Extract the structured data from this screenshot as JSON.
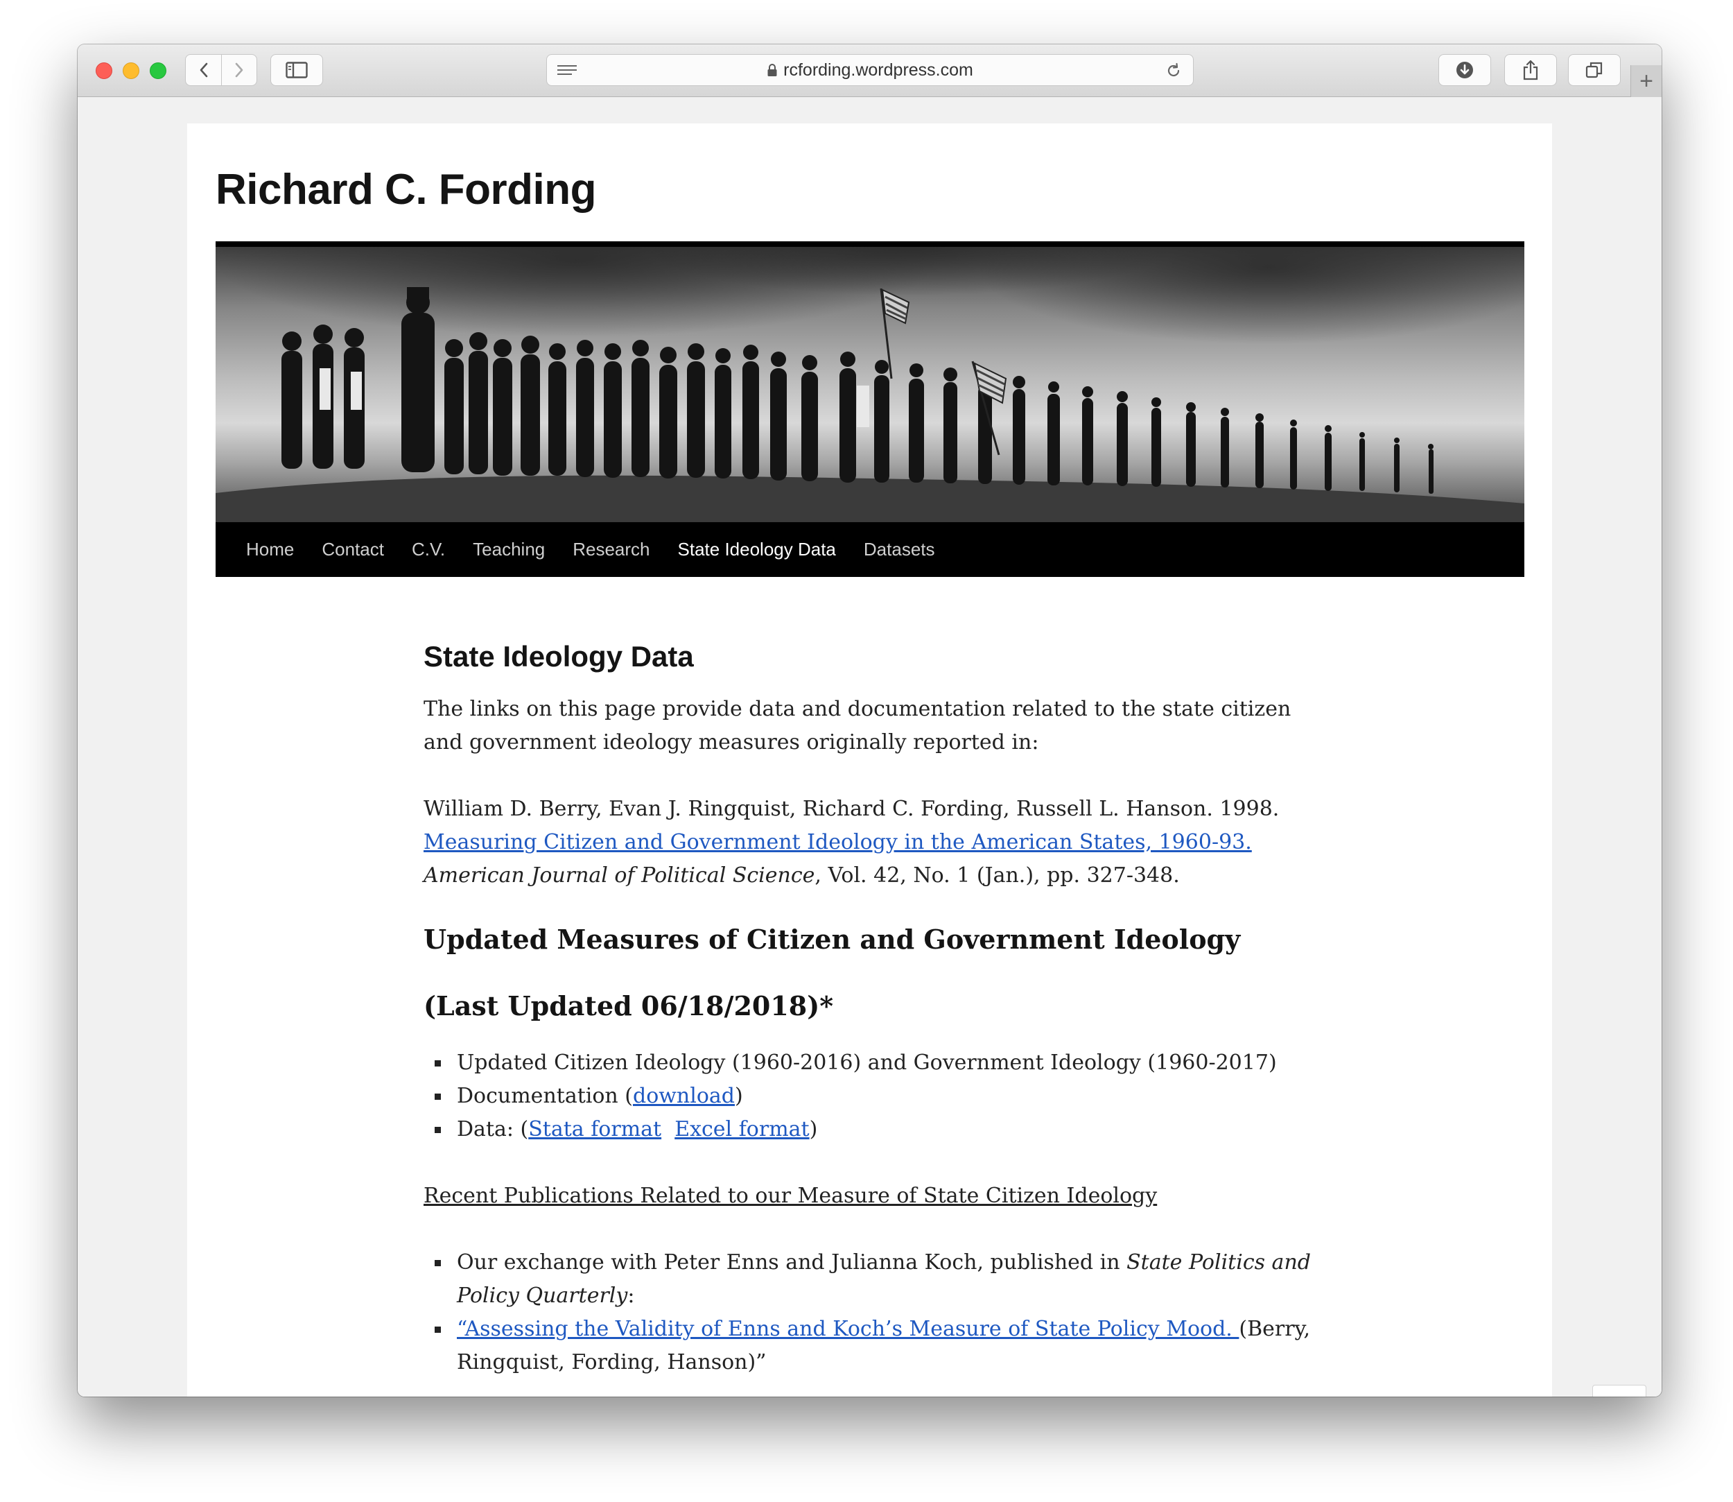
{
  "browser": {
    "url": "rcfording.wordpress.com"
  },
  "site": {
    "title": "Richard C. Fording"
  },
  "nav": {
    "items": [
      "Home",
      "Contact",
      "C.V.",
      "Teaching",
      "Research",
      "State Ideology Data",
      "Datasets"
    ],
    "current": "State Ideology Data"
  },
  "content": {
    "page_title": "State Ideology Data",
    "intro": " The links on this page provide data and documentation related to the state citizen and government ideology measures originally reported in:",
    "citation": {
      "authors": "William D. Berry, Evan J. Ringquist, Richard C. Fording, Russell L. Hanson. 1998.",
      "title_link": "Measuring Citizen and Government Ideology in the American States, 1960-93.",
      "journal": "American Journal of Political Science",
      "details": ", Vol. 42, No. 1 (Jan.), pp. 327-348."
    },
    "updated_heading_1": "Updated Measures of Citizen and Government Ideology",
    "updated_heading_2": "(Last Updated 06/18/2018)*",
    "list_1": {
      "item_1": "Updated Citizen Ideology (1960-2016) and Government Ideology (1960-2017)",
      "item_2_prefix": "Documentation (",
      "item_2_link": "download",
      "item_2_suffix": ")",
      "item_3_prefix": "Data: (",
      "item_3_link_1": "Stata format",
      "item_3_link_2": "Excel format",
      "item_3_suffix": ")"
    },
    "recent_heading": "Recent Publications Related to our Measure of State Citizen Ideology",
    "list_2": {
      "item_1_prefix": "Our exchange with Peter Enns and Julianna Koch, published in ",
      "item_1_journal": "State Politics and Policy Quarterly",
      "item_1_suffix": ":",
      "item_2_link": "“Assessing the Validity of Enns and Koch’s Measure of State Policy Mood. ",
      "item_2_suffix": "(Berry, Ringquist, Fording, Hanson)”"
    }
  },
  "colors": {
    "link": "#1e58c1",
    "nav_background": "#000000",
    "nav_text": "#cfcfcf",
    "nav_current": "#ffffff"
  }
}
